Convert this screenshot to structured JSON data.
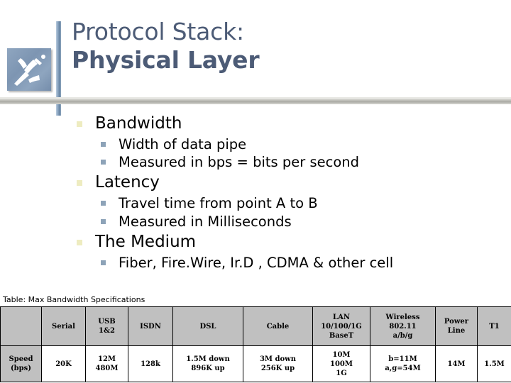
{
  "slide": {
    "title_line1": "Protocol Stack:",
    "title_line2": "Physical Layer",
    "accent_color": "#4c5b76",
    "rule_color": "#a9a9a3",
    "logo_name": "darts-logo"
  },
  "body": {
    "bullets": [
      {
        "label": "Bandwidth",
        "sub": [
          "Width of data pipe",
          "Measured in bps = bits per second"
        ]
      },
      {
        "label": "Latency",
        "sub": [
          "Travel time from point A to B",
          "Measured in Milliseconds"
        ]
      },
      {
        "label": "The Medium",
        "sub": [
          "Fiber, Fire.Wire, Ir.D , CDMA & other cell"
        ]
      }
    ],
    "bullet1_color": "#eeecc0",
    "bullet2_color": "#8da3b8"
  },
  "table": {
    "caption": "Table: Max Bandwidth Specifications",
    "corner": "",
    "headers": [
      "Serial",
      "USB\n1&2",
      "ISDN",
      "DSL",
      "Cable",
      "LAN\n10/100/1G\nBaseT",
      "Wireless\n802.11\na/b/g",
      "Power\nLine",
      "T1"
    ],
    "header_lines": [
      [
        "Serial"
      ],
      [
        "USB",
        "1&2"
      ],
      [
        "ISDN"
      ],
      [
        "DSL"
      ],
      [
        "Cable"
      ],
      [
        "LAN",
        "10/100/1G",
        "BaseT"
      ],
      [
        "Wireless",
        "802.11",
        "a/b/g"
      ],
      [
        "Power",
        "Line"
      ],
      [
        "T1"
      ]
    ],
    "row_label_lines": [
      "Speed",
      "(bps)"
    ],
    "row_label": "Speed (bps)",
    "values": [
      "20K",
      "12M 480M",
      "128k",
      "1.5M down 896K up",
      "3M down 256K up",
      "10M 100M 1G",
      "b=11M a,g=54M",
      "14M",
      "1.5M"
    ],
    "value_lines": [
      [
        "20K"
      ],
      [
        "12M",
        "480M"
      ],
      [
        "128k"
      ],
      [
        "1.5M down",
        "896K up"
      ],
      [
        "3M down",
        "256K up"
      ],
      [
        "10M",
        "100M",
        "1G"
      ],
      [
        "b=11M",
        "a,g=54M"
      ],
      [
        "14M"
      ],
      [
        "1.5M"
      ]
    ],
    "header_bg": "#c0c0c0",
    "body_bg": "#ffffff"
  }
}
